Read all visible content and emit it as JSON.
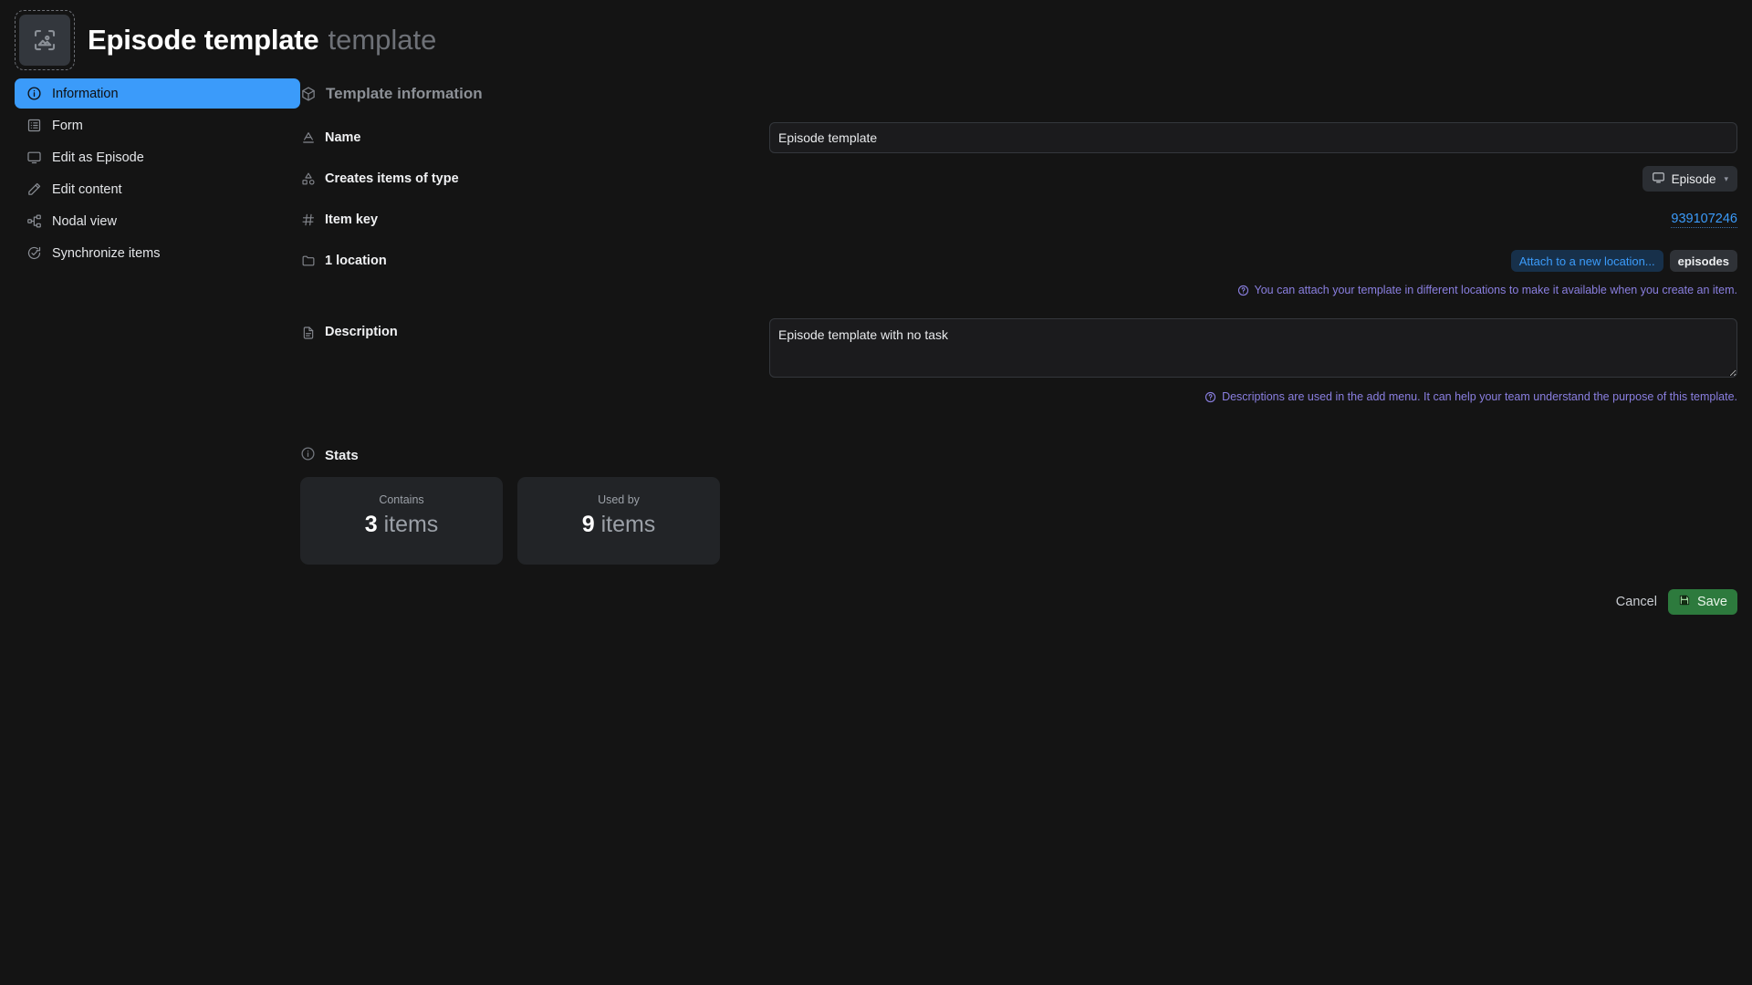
{
  "header": {
    "thumbnail_icon": "image-placeholder-icon",
    "title": "Episode template",
    "subtitle": "template"
  },
  "sidebar": {
    "items": [
      {
        "label": "Information",
        "icon": "info-circle-icon",
        "active": true
      },
      {
        "label": "Form",
        "icon": "form-list-icon",
        "active": false
      },
      {
        "label": "Edit as Episode",
        "icon": "monitor-icon",
        "active": false
      },
      {
        "label": "Edit content",
        "icon": "pencil-icon",
        "active": false
      },
      {
        "label": "Nodal view",
        "icon": "nodal-graph-icon",
        "active": false
      },
      {
        "label": "Synchronize items",
        "icon": "sync-check-icon",
        "active": false
      }
    ]
  },
  "main": {
    "section_title": "Template information",
    "section_icon": "cube-icon",
    "fields": {
      "name": {
        "label": "Name",
        "icon": "letter-a-icon",
        "value": "Episode template",
        "placeholder": "Name"
      },
      "creates_items_of_type": {
        "label": "Creates items of type",
        "icon": "shapes-icon",
        "selected": "Episode",
        "selected_icon": "monitor-icon",
        "caret": "▾"
      },
      "item_key": {
        "label": "Item key",
        "icon": "hash-icon",
        "value": "939107246"
      },
      "locations": {
        "label": "1 location",
        "icon": "folder-icon",
        "add_chip": "Attach to a new location...",
        "chips": [
          "episodes"
        ],
        "hint": "You can attach your template in different locations to make it available when you create an item.",
        "hint_icon": "question-circle-icon"
      },
      "description": {
        "label": "Description",
        "icon": "document-icon",
        "value": "Episode template with no task",
        "placeholder": "Description",
        "hint": "Descriptions are used in the add menu. It can help your team understand the purpose of this template.",
        "hint_icon": "question-circle-icon"
      }
    },
    "stats": {
      "title": "Stats",
      "icon": "info-circle-icon",
      "cards": [
        {
          "caption": "Contains",
          "number": "3",
          "unit": "items"
        },
        {
          "caption": "Used by",
          "number": "9",
          "unit": "items"
        }
      ]
    },
    "actions": {
      "cancel_label": "Cancel",
      "save_label": "Save",
      "save_icon": "floppy-save-icon"
    }
  },
  "colors": {
    "page_background": "#141414",
    "accent_blue": "#3b9bfa",
    "hint_purple": "#8a7fe0",
    "save_green": "#2d7a3d",
    "card_background": "#222427"
  }
}
